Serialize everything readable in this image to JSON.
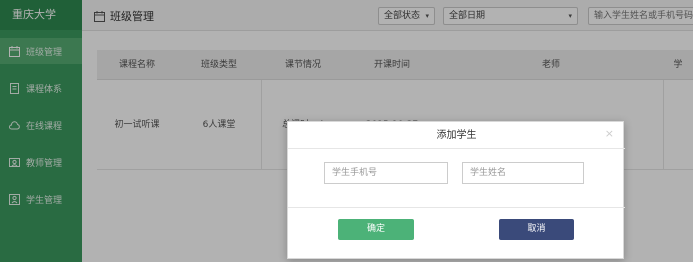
{
  "app": {
    "name": "重庆大学"
  },
  "sidebar": {
    "items": [
      {
        "label": "班级管理",
        "icon": "calendar-icon",
        "active": true
      },
      {
        "label": "课程体系",
        "icon": "book-icon",
        "active": false
      },
      {
        "label": "在线课程",
        "icon": "cloud-icon",
        "active": false
      },
      {
        "label": "教师管理",
        "icon": "person-card-icon",
        "active": false
      },
      {
        "label": "学生管理",
        "icon": "student-icon",
        "active": false
      }
    ]
  },
  "header": {
    "title": "班级管理",
    "status_filter": "全部状态",
    "date_filter": "全部日期",
    "search_placeholder": "输入学生姓名或手机号码"
  },
  "table": {
    "columns": [
      "课程名称",
      "班级类型",
      "课节情况",
      "开课时间",
      "老师",
      "学"
    ],
    "rows": [
      {
        "course": "初一试听课",
        "class_type": "6人课堂",
        "lessons": "总课时：4",
        "start_time": "2015-10-27",
        "teacher": "",
        "extra": ""
      }
    ]
  },
  "modal": {
    "title": "添加学生",
    "close": "×",
    "phone_placeholder": "学生手机号",
    "name_placeholder": "学生姓名",
    "confirm_label": "确定",
    "cancel_label": "取消"
  },
  "colors": {
    "sidebar": "#3c9a5f",
    "confirm": "#4cb278",
    "cancel": "#3a4a7a"
  }
}
